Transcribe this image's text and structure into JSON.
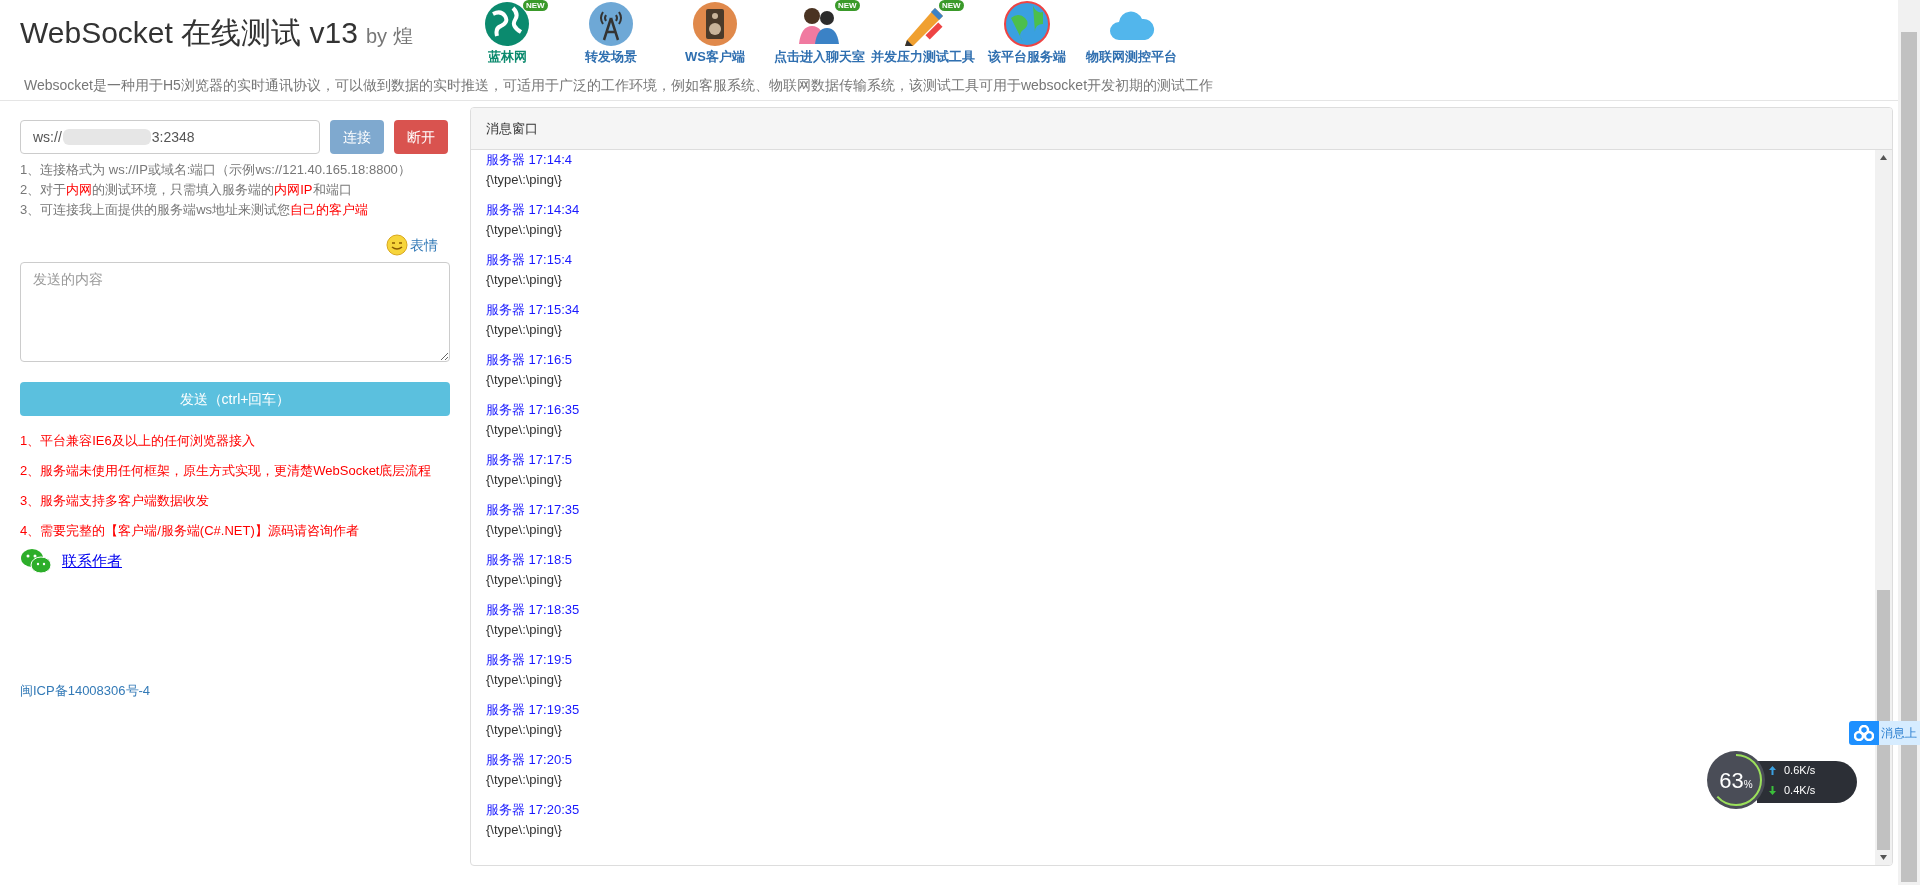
{
  "header": {
    "title": "WebSocket 在线测试 v13",
    "byline": "by 煌",
    "description": "Websocket是一种用于H5浏览器的实时通讯协议，可以做到数据的实时推送，可适用于广泛的工作环境，例如客服系统、物联网数据传输系统，该测试工具可用于websocket开发初期的测试工作"
  },
  "nav": [
    {
      "kind": "globe",
      "label": "蓝林网",
      "new": true,
      "badge": "NEW",
      "color": "#0b8a6e"
    },
    {
      "kind": "tower",
      "label": "转发场景",
      "new": false,
      "color": "#2f6fb0"
    },
    {
      "kind": "speaker",
      "label": "WS客户端",
      "new": false,
      "color": "#2f6fb0"
    },
    {
      "kind": "people",
      "label": "点击进入聊天室",
      "new": true,
      "badge": "NEW",
      "color": "#2f6fb0"
    },
    {
      "kind": "pencil",
      "label": "并发压力测试工具",
      "new": true,
      "badge": "NEW",
      "color": "#2f6fb0"
    },
    {
      "kind": "earth",
      "label": "该平台服务端",
      "new": false,
      "color": "#2f6fb0"
    },
    {
      "kind": "cloud",
      "label": "物联网测控平台",
      "new": false,
      "color": "#2f6fb0"
    }
  ],
  "connection": {
    "value_start": "ws://",
    "value_end": "3:2348",
    "redacted": true,
    "connect_button": "连接",
    "disconnect_button": "断开"
  },
  "hints": [
    [
      {
        "text": "1、连接格式为 ws://IP或域名:端口（示例ws://121.40.165.18:8800）",
        "highlight": false
      }
    ],
    [
      {
        "text": "2、对于",
        "highlight": false
      },
      {
        "text": "内网",
        "highlight": true
      },
      {
        "text": "的测试环境，只需填入服务端的",
        "highlight": false
      },
      {
        "text": "内网IP",
        "highlight": true
      },
      {
        "text": "和端口",
        "highlight": false
      }
    ],
    [
      {
        "text": "3、可连接我上面提供的服务端ws地址来测试您",
        "highlight": false
      },
      {
        "text": "自己的客户端",
        "highlight": true
      }
    ]
  ],
  "emoji_link": "表情",
  "message_input": {
    "placeholder": "发送的内容"
  },
  "send_button": "发送（ctrl+回车）",
  "features": [
    "1、平台兼容IE6及以上的任何浏览器接入",
    "2、服务端未使用任何框架，原生方式实现，更清楚WebSocket底层流程",
    "3、服务端支持多客户端数据收发",
    "4、需要完整的【客户端/服务端(C#.NET)】源码请咨询作者"
  ],
  "contact_link": "联系作者",
  "icp": "闽ICP备14008306号-4",
  "message_window": {
    "title": "消息窗口",
    "messages": [
      {
        "sender": "服务器",
        "time": "17:14:4",
        "body": "{\\type\\:\\ping\\}"
      },
      {
        "sender": "服务器",
        "time": "17:14:34",
        "body": "{\\type\\:\\ping\\}"
      },
      {
        "sender": "服务器",
        "time": "17:15:4",
        "body": "{\\type\\:\\ping\\}"
      },
      {
        "sender": "服务器",
        "time": "17:15:34",
        "body": "{\\type\\:\\ping\\}"
      },
      {
        "sender": "服务器",
        "time": "17:16:5",
        "body": "{\\type\\:\\ping\\}"
      },
      {
        "sender": "服务器",
        "time": "17:16:35",
        "body": "{\\type\\:\\ping\\}"
      },
      {
        "sender": "服务器",
        "time": "17:17:5",
        "body": "{\\type\\:\\ping\\}"
      },
      {
        "sender": "服务器",
        "time": "17:17:35",
        "body": "{\\type\\:\\ping\\}"
      },
      {
        "sender": "服务器",
        "time": "17:18:5",
        "body": "{\\type\\:\\ping\\}"
      },
      {
        "sender": "服务器",
        "time": "17:18:35",
        "body": "{\\type\\:\\ping\\}"
      },
      {
        "sender": "服务器",
        "time": "17:19:5",
        "body": "{\\type\\:\\ping\\}"
      },
      {
        "sender": "服务器",
        "time": "17:19:35",
        "body": "{\\type\\:\\ping\\}"
      },
      {
        "sender": "服务器",
        "time": "17:20:5",
        "body": "{\\type\\:\\ping\\}"
      },
      {
        "sender": "服务器",
        "time": "17:20:35",
        "body": "{\\type\\:\\ping\\}"
      }
    ]
  },
  "cloud_tab": {
    "label": "消息上"
  },
  "speed_widget": {
    "percent": "63",
    "unit": "%",
    "upload": "0.6K/s",
    "download": "0.4K/s"
  }
}
